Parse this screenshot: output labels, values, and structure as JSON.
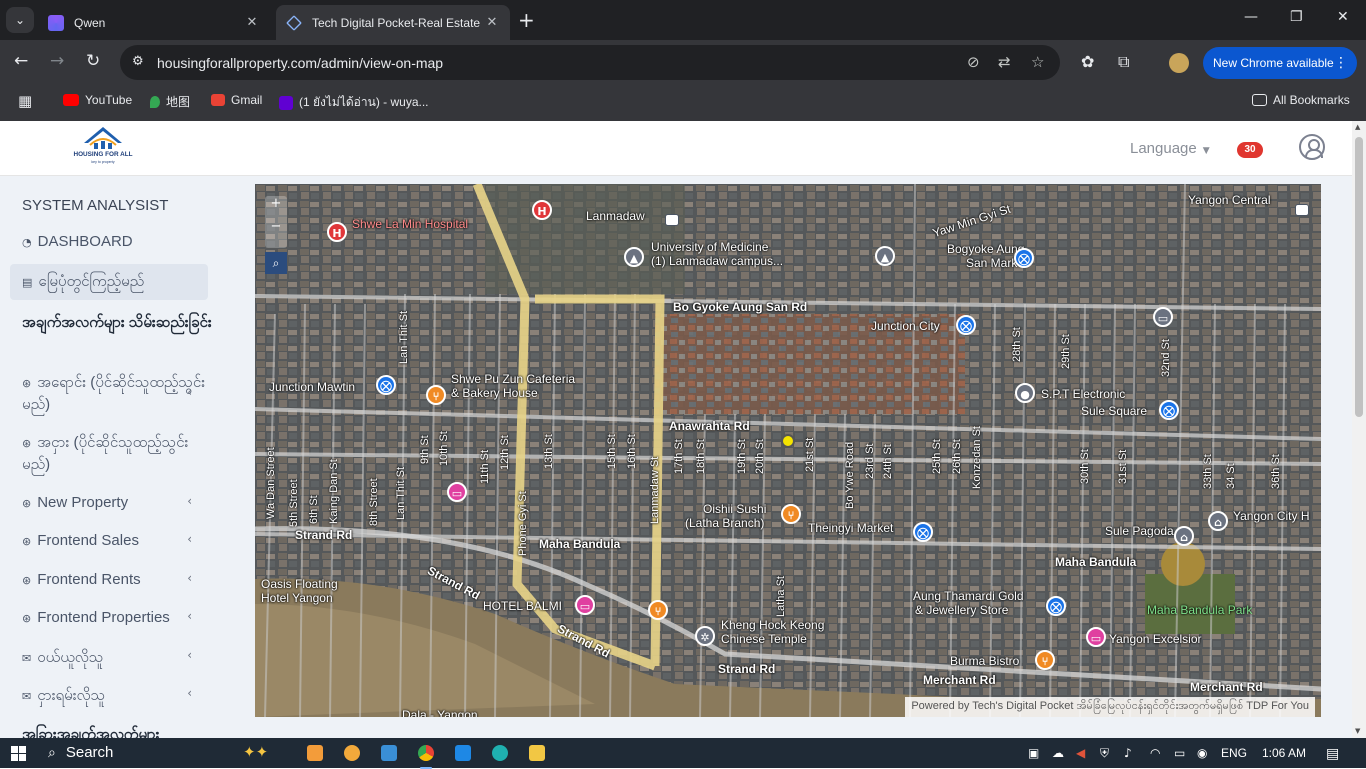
{
  "browser": {
    "tabs": [
      {
        "title": "Qwen",
        "icon": "qwen-icon"
      },
      {
        "title": "Tech Digital Pocket-Real Estate",
        "icon": "site-icon"
      }
    ],
    "url": "housingforallproperty.com/admin/view-on-map",
    "update_label": "New Chrome available",
    "bookmarks": [
      {
        "label": "YouTube",
        "color": "#ff0000"
      },
      {
        "label": "地图",
        "color": "#34a853"
      },
      {
        "label": "Gmail",
        "color": "#ea4335"
      },
      {
        "label": "(1 ยังไม่ได้อ่าน) - wuya...",
        "color": "#6001d2"
      }
    ],
    "all_bookmarks": "All Bookmarks"
  },
  "header": {
    "logo_text": "HOUSING FOR ALL",
    "logo_sub": "key to property",
    "language_label": "Language",
    "notification_count": "30"
  },
  "sidebar": {
    "role": "SYSTEM ANALYSIST",
    "dashboard": "DASHBOARD",
    "map_view": "မြေပုံတွင်ကြည့်မည်",
    "section_records": "အချက်အလက်များ သိမ်းဆည်းခြင်း",
    "items": [
      {
        "label": "အရောင်း (ပိုင်ဆိုင်သူထည့်သွင်းမည်)"
      },
      {
        "label": "အငှား (ပိုင်ဆိုင်သူထည့်သွင်းမည်)"
      },
      {
        "label": "New Property"
      },
      {
        "label": "Frontend Sales"
      },
      {
        "label": "Frontend Rents"
      },
      {
        "label": "Frontend Properties"
      },
      {
        "label": "ဝယ်ယူလိုသူ"
      },
      {
        "label": "ငှားရမ်းလိုသူ"
      }
    ],
    "section_more": "အခြားအချက်အလက်များ"
  },
  "map": {
    "labels": {
      "shwe_la_min": "Shwe La Min Hospital",
      "lanmadaw": "Lanmadaw",
      "uni_med": "University of Medicine",
      "uni_med2": "(1) Lanmadaw campus...",
      "bogyoke": "Bogyoke Aung",
      "bogyoke2": "San Market",
      "yawmingyi": "Yaw Min Gyi St",
      "yangon_central": "Yangon Central",
      "bogyoke_rd": "Bo Gyoke Aung San Rd",
      "junction_city": "Junction City",
      "junction_mawtin": "Junction Mawtin",
      "shwe_pu_zun": "Shwe Pu Zun Cafeteria",
      "shwe_pu_zun2": "& Bakery House",
      "spt": "S.P.T Electronic",
      "sule_square": "Sule Square",
      "anawrahta": "Anawrahta Rd",
      "oishii": "Oishii Sushi",
      "oishii2": "(Latha Branch)",
      "theingyi": "Theingyi Market",
      "strand": "Strand Rd",
      "maha_bandula": "Maha Bandula",
      "maha_bandula2": "Maha Bandula",
      "sule_pagoda": "Sule Pagoda",
      "yangon_city": "Yangon City H",
      "oasis": "Oasis Floating",
      "oasis2": "Hotel Yangon",
      "hotel_balmi": "HOTEL BALMI",
      "kheng_hock": "Kheng Hock Keong",
      "kheng_hock2": "Chinese Temple",
      "aung_thamardi": "Aung Thamardi Gold",
      "aung_thamardi2": "& Jewellery Store",
      "mb_park": "Maha Bandula Park",
      "yangon_excelsior": "Yangon Excelsior",
      "burma_bistro": "Burma Bistro",
      "merchant": "Merchant Rd",
      "merchant2": "Merchant Rd",
      "strand2": "Strand Rd",
      "strand3": "Strand Rd",
      "strand4": "Strand Rd",
      "dala": "Dala - Yangon",
      "wadan": "Wa Dan Street",
      "lanthit": "Lan Thit St",
      "phonegyi": "Phone Gyi St",
      "lanmadaw_st": "Lanmadaw St",
      "bo_ywe": "Bo Ywe Road",
      "latha": "Latha St",
      "konzedan": "Konzedan St",
      "st_5": "5th Street",
      "st_6": "6th St",
      "kaingdan": "Kaing Dan St",
      "st_8": "8th Street",
      "st_9": "9th St",
      "st_10": "10th St",
      "st_11": "11th St",
      "st_12": "12th St",
      "st_13": "13th St",
      "st_15": "15th St",
      "st_16": "16th St",
      "st_17": "17th St",
      "st_18": "18th St",
      "st_19": "19th St",
      "st_20": "20th St",
      "st_21": "21st St",
      "st_23": "23rd St",
      "st_24": "24th St",
      "st_25": "25th St",
      "st_26": "26th St",
      "st_28": "28th St",
      "st_29": "29th St",
      "st_30": "30th St",
      "st_31": "31st St",
      "st_32": "32nd St",
      "st_33": "33th St",
      "st_34": "34 St",
      "st_36": "36th St"
    },
    "attribution": "Powered by Tech's Digital Pocket အိမ်ခြံမြေလုပ်ငန်းရှင်တိုင်းအတွက်မရှိမဖြစ် TDP For You"
  },
  "taskbar": {
    "search": "Search",
    "lang": "ENG",
    "time": "1:06 AM"
  }
}
